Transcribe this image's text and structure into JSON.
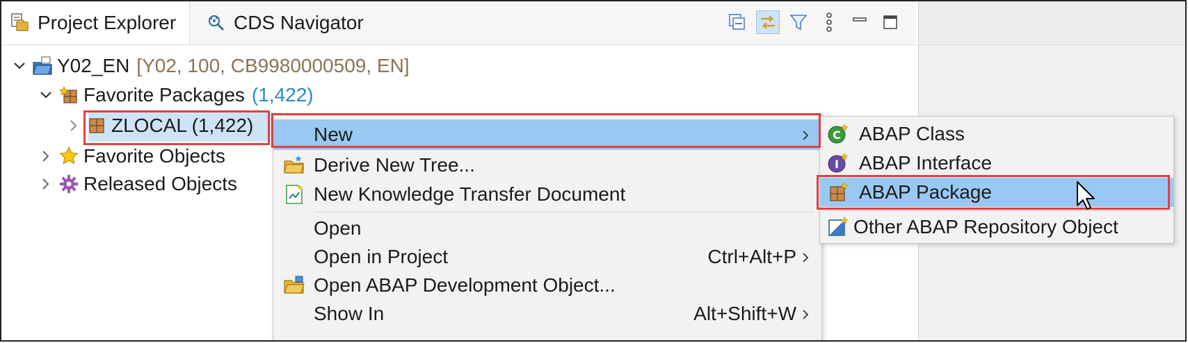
{
  "tabs": {
    "project_explorer": "Project Explorer",
    "cds_navigator": "CDS Navigator"
  },
  "toolbar": {
    "collapse_icon": "collapse-all-icon",
    "link_icon": "link-with-editor-icon",
    "filter_icon": "filter-icon",
    "more_icon": "view-menu-icon",
    "minimize_icon": "minimize-icon",
    "maximize_icon": "maximize-icon"
  },
  "tree": {
    "project": {
      "name": "Y02_EN",
      "details": "[Y02, 100, CB9980000509, EN]"
    },
    "favorite_packages": {
      "label": "Favorite Packages",
      "count": "(1,422)"
    },
    "zlocal": {
      "label": "ZLOCAL (1,422)"
    },
    "favorite_objects": {
      "label": "Favorite Objects"
    },
    "released_objects": {
      "label": "Released Objects"
    }
  },
  "context_menu": {
    "items": [
      {
        "label": "New",
        "shortcut": "",
        "has_submenu": true,
        "active": true
      },
      {
        "label": "Derive New Tree...",
        "shortcut": ""
      },
      {
        "label": "New Knowledge Transfer Document",
        "shortcut": ""
      },
      {
        "label": "Open",
        "shortcut": ""
      },
      {
        "label": "Open in Project",
        "shortcut": "Ctrl+Alt+P",
        "has_submenu": true
      },
      {
        "label": "Open ABAP Development Object...",
        "shortcut": ""
      },
      {
        "label": "Show In",
        "shortcut": "Alt+Shift+W",
        "has_submenu": true
      }
    ]
  },
  "submenu": {
    "items": [
      {
        "label": "ABAP Class"
      },
      {
        "label": "ABAP Interface"
      },
      {
        "label": "ABAP Package",
        "active": true
      },
      {
        "label": "Other ABAP Repository Object"
      }
    ]
  },
  "colors": {
    "selection": "#cfe3f7",
    "menu_active": "#99c8f2",
    "highlight_box": "#e04040",
    "count_blue": "#2b87c8",
    "details_brown": "#8b7355"
  }
}
